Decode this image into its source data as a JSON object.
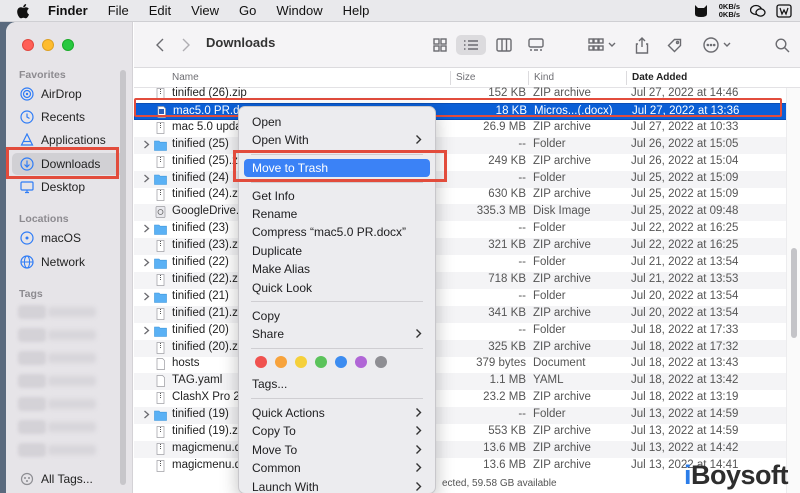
{
  "menubar": {
    "items": [
      "Finder",
      "File",
      "Edit",
      "View",
      "Go",
      "Window",
      "Help"
    ],
    "net_up": "0KB/s",
    "net_down": "0KB/s"
  },
  "window": {
    "title": "Downloads"
  },
  "sidebar": {
    "favorites_label": "Favorites",
    "favorites": [
      {
        "label": "AirDrop",
        "icon": "airdrop-icon"
      },
      {
        "label": "Recents",
        "icon": "clock-icon"
      },
      {
        "label": "Applications",
        "icon": "applications-icon"
      },
      {
        "label": "Downloads",
        "icon": "download-icon",
        "active": true
      },
      {
        "label": "Desktop",
        "icon": "desktop-icon"
      }
    ],
    "locations_label": "Locations",
    "locations": [
      {
        "label": "macOS",
        "icon": "disk-icon"
      },
      {
        "label": "Network",
        "icon": "globe-icon"
      }
    ],
    "tags_label": "Tags",
    "all_tags": "All Tags..."
  },
  "columns": {
    "name": "Name",
    "size": "Size",
    "kind": "Kind",
    "date": "Date Added"
  },
  "files": [
    {
      "name": "tinified (26).zip",
      "size": "152 KB",
      "kind": "ZIP archive",
      "date": "Jul 27, 2022 at 14:46",
      "type": "zip"
    },
    {
      "name": "mac5.0 PR.docx",
      "size": "18 KB",
      "kind": "Micros...(.docx)",
      "date": "Jul 27, 2022 at 13:36",
      "type": "doc",
      "selected": true
    },
    {
      "name": "mac 5.0 upda",
      "size": "26.9 MB",
      "kind": "ZIP archive",
      "date": "Jul 27, 2022 at 10:33",
      "type": "zip"
    },
    {
      "name": "tinified (25)",
      "size": "--",
      "kind": "Folder",
      "date": "Jul 26, 2022 at 15:05",
      "type": "folder"
    },
    {
      "name": "tinified (25).z",
      "size": "249 KB",
      "kind": "ZIP archive",
      "date": "Jul 26, 2022 at 15:04",
      "type": "zip"
    },
    {
      "name": "tinified (24)",
      "size": "--",
      "kind": "Folder",
      "date": "Jul 25, 2022 at 15:09",
      "type": "folder"
    },
    {
      "name": "tinified (24).z",
      "size": "630 KB",
      "kind": "ZIP archive",
      "date": "Jul 25, 2022 at 15:09",
      "type": "zip"
    },
    {
      "name": "GoogleDrive.d",
      "size": "335.3 MB",
      "kind": "Disk Image",
      "date": "Jul 25, 2022 at 09:48",
      "type": "dmg"
    },
    {
      "name": "tinified (23)",
      "size": "--",
      "kind": "Folder",
      "date": "Jul 22, 2022 at 16:25",
      "type": "folder"
    },
    {
      "name": "tinified (23).z",
      "size": "321 KB",
      "kind": "ZIP archive",
      "date": "Jul 22, 2022 at 16:25",
      "type": "zip"
    },
    {
      "name": "tinified (22)",
      "size": "--",
      "kind": "Folder",
      "date": "Jul 21, 2022 at 13:54",
      "type": "folder"
    },
    {
      "name": "tinified (22).z",
      "size": "718 KB",
      "kind": "ZIP archive",
      "date": "Jul 21, 2022 at 13:53",
      "type": "zip"
    },
    {
      "name": "tinified (21)",
      "size": "--",
      "kind": "Folder",
      "date": "Jul 20, 2022 at 13:54",
      "type": "folder"
    },
    {
      "name": "tinified (21).zi",
      "size": "341 KB",
      "kind": "ZIP archive",
      "date": "Jul 20, 2022 at 13:54",
      "type": "zip"
    },
    {
      "name": "tinified (20)",
      "size": "--",
      "kind": "Folder",
      "date": "Jul 18, 2022 at 17:33",
      "type": "folder"
    },
    {
      "name": "tinified (20).zi",
      "size": "325 KB",
      "kind": "ZIP archive",
      "date": "Jul 18, 2022 at 17:32",
      "type": "zip"
    },
    {
      "name": "hosts",
      "size": "379 bytes",
      "kind": "Document",
      "date": "Jul 18, 2022 at 13:43",
      "type": "doc"
    },
    {
      "name": "TAG.yaml",
      "size": "1.1 MB",
      "kind": "YAML",
      "date": "Jul 18, 2022 at 13:42",
      "type": "doc"
    },
    {
      "name": "ClashX Pro 2.",
      "size": "23.2 MB",
      "kind": "ZIP archive",
      "date": "Jul 18, 2022 at 13:19",
      "type": "zip"
    },
    {
      "name": "tinified (19)",
      "size": "--",
      "kind": "Folder",
      "date": "Jul 13, 2022 at 14:59",
      "type": "folder"
    },
    {
      "name": "tinified (19).z",
      "size": "553 KB",
      "kind": "ZIP archive",
      "date": "Jul 13, 2022 at 14:59",
      "type": "zip"
    },
    {
      "name": "magicmenu.dr",
      "size": "13.6 MB",
      "kind": "ZIP archive",
      "date": "Jul 13, 2022 at 14:42",
      "type": "zip"
    },
    {
      "name": "magicmenu.d",
      "size": "13.6 MB",
      "kind": "ZIP archive",
      "date": "Jul 13, 2022 at 14:41",
      "type": "zip"
    }
  ],
  "status": "ected, 59.58 GB available",
  "context_menu": {
    "items": [
      {
        "label": "Open"
      },
      {
        "label": "Open With",
        "submenu": true
      },
      {
        "label": "Move to Trash",
        "highlighted": true
      },
      {
        "label": "Get Info"
      },
      {
        "label": "Rename"
      },
      {
        "label": "Compress “mac5.0 PR.docx”"
      },
      {
        "label": "Duplicate"
      },
      {
        "label": "Make Alias"
      },
      {
        "label": "Quick Look"
      },
      {
        "label": "Copy"
      },
      {
        "label": "Share",
        "submenu": true
      },
      {
        "label": "Tags..."
      },
      {
        "label": "Quick Actions",
        "submenu": true
      },
      {
        "label": "Copy To",
        "submenu": true
      },
      {
        "label": "Move To",
        "submenu": true
      },
      {
        "label": "Common",
        "submenu": true
      },
      {
        "label": "Launch With",
        "submenu": true
      }
    ],
    "tag_colors": [
      "#f0524f",
      "#f7a33c",
      "#f5d03b",
      "#5bc35b",
      "#3c8cf0",
      "#b066d6",
      "#8e8e93"
    ]
  },
  "watermark": {
    "prefix": "i",
    "rest": "Boysoft"
  }
}
